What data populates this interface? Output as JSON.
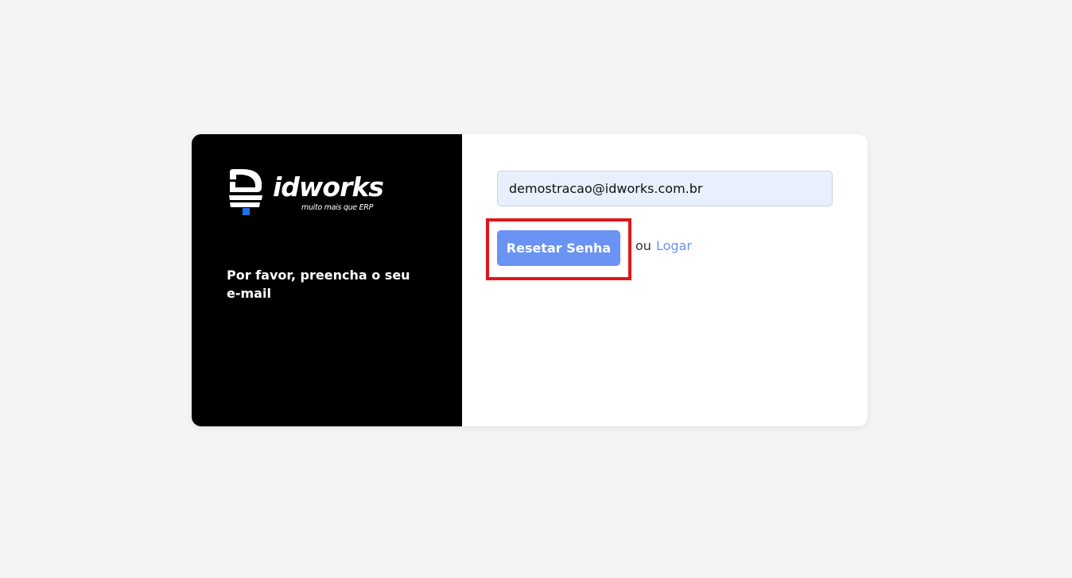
{
  "brand": {
    "name": "idworks",
    "tagline": "muito mais que ERP"
  },
  "left_panel": {
    "instruction": "Por favor, preencha o seu e-mail"
  },
  "form": {
    "email_value": "demostracao@idworks.com.br",
    "reset_button_label": "Resetar Senha",
    "or_text": "ou",
    "login_link_label": "Logar"
  },
  "colors": {
    "page_background": "#f4f4f4",
    "left_panel": "#000000",
    "accent": "#6b93f4",
    "input_background": "#e8f0fd",
    "highlight": "#e0161b",
    "logo_square": "#1a73e8"
  }
}
